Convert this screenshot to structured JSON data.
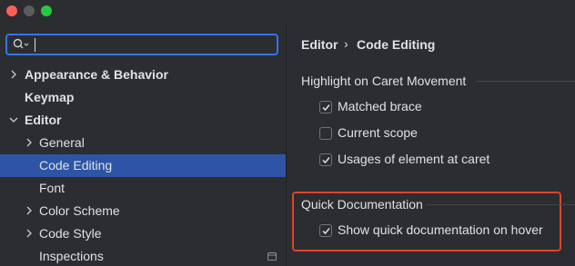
{
  "window": {
    "controls": [
      "close",
      "minimize",
      "maximize"
    ]
  },
  "search": {
    "value": "",
    "icon": "search-icon"
  },
  "sidebar": {
    "items": [
      {
        "label": "Appearance & Behavior",
        "bold": true,
        "expandable": true,
        "expanded": false
      },
      {
        "label": "Keymap",
        "bold": true,
        "expandable": false
      },
      {
        "label": "Editor",
        "bold": true,
        "expandable": true,
        "expanded": true
      },
      {
        "label": "General",
        "bold": false,
        "expandable": true,
        "expanded": false
      },
      {
        "label": "Code Editing",
        "bold": false,
        "expandable": false,
        "selected": true
      },
      {
        "label": "Font",
        "bold": false,
        "expandable": false
      },
      {
        "label": "Color Scheme",
        "bold": false,
        "expandable": true,
        "expanded": false
      },
      {
        "label": "Code Style",
        "bold": false,
        "expandable": true,
        "expanded": false
      },
      {
        "label": "Inspections",
        "bold": false,
        "expandable": false,
        "icon": "project-settings-icon"
      }
    ]
  },
  "breadcrumb": {
    "parent": "Editor",
    "separator": "›",
    "current": "Code Editing"
  },
  "sections": [
    {
      "title": "Highlight on Caret Movement",
      "options": [
        {
          "label": "Matched brace",
          "checked": true
        },
        {
          "label": "Current scope",
          "checked": false
        },
        {
          "label": "Usages of element at caret",
          "checked": true
        }
      ]
    },
    {
      "title": "Quick Documentation",
      "options": [
        {
          "label": "Show quick documentation on hover",
          "checked": true
        }
      ]
    }
  ],
  "colors": {
    "selection": "#2e55a5",
    "focus_ring": "#3574f0",
    "highlight_box": "#e0442b"
  }
}
